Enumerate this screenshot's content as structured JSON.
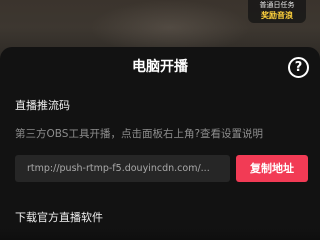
{
  "task_badge": {
    "line1": "普通日任务",
    "line2": "奖励音浪"
  },
  "sheet": {
    "title": "电脑开播",
    "help_icon": "?"
  },
  "stream_section": {
    "heading": "直播推流码",
    "description": "第三方OBS工具开播，点击面板右上角?查看设置说明",
    "url_value": "rtmp://push-rtmp-f5.douyincdn.com/...",
    "copy_button": "复制地址"
  },
  "download_section": {
    "heading": "下载官方直播软件"
  },
  "colors": {
    "accent": "#f23b55",
    "badge_highlight": "#ffd23d",
    "sheet_background": "#121212"
  }
}
